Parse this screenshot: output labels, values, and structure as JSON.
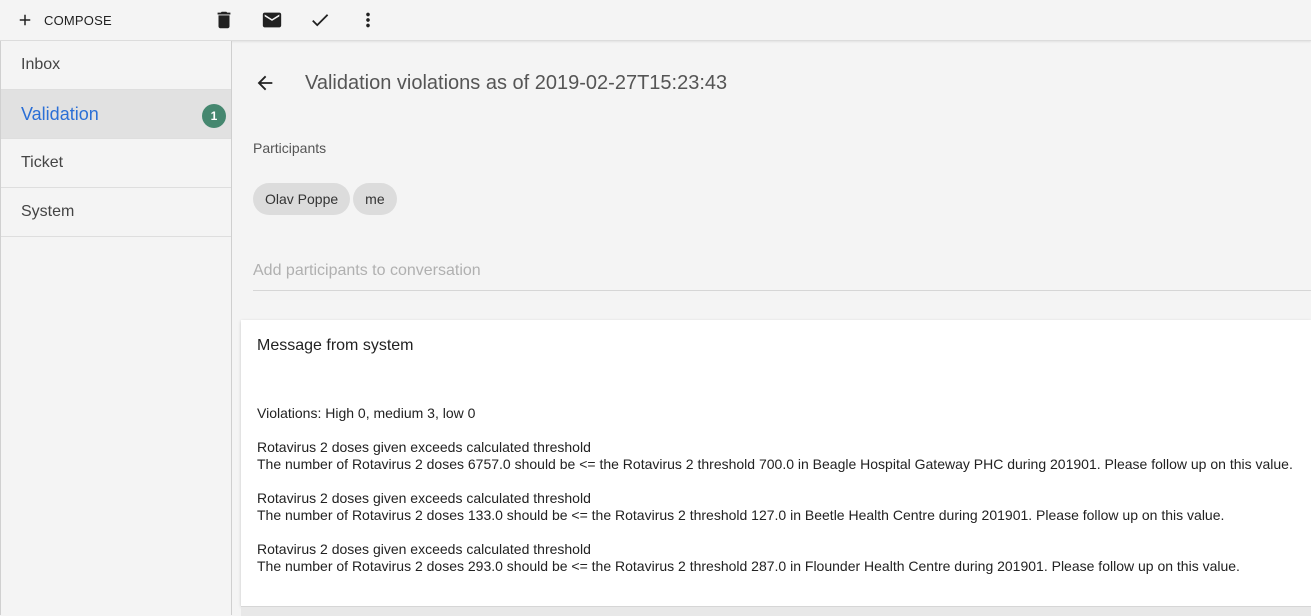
{
  "toolbar": {
    "compose_label": "COMPOSE",
    "icons": [
      "plus-icon",
      "trash-icon",
      "mail-icon",
      "check-icon",
      "more-vert-icon"
    ]
  },
  "sidebar": {
    "items": [
      {
        "label": "Inbox"
      },
      {
        "label": "Validation",
        "badge": "1"
      },
      {
        "label": "Ticket"
      },
      {
        "label": "System"
      }
    ],
    "active_color": "#2b6fd6",
    "badge_color": "#45876f"
  },
  "conversation": {
    "subject": "Validation violations as of 2019-02-27T15:23:43",
    "participants_label": "Participants",
    "participants": [
      "Olav Poppe",
      "me"
    ],
    "add_placeholder": "Add participants to conversation"
  },
  "message": {
    "title": "Message from system",
    "summary": "Violations: High 0, medium 3, low 0",
    "violations": [
      {
        "heading": "Rotavirus 2 doses given exceeds calculated threshold",
        "detail": "The number of Rotavirus 2 doses 6757.0 should be <= the Rotavirus 2 threshold 700.0 in Beagle Hospital Gateway PHC during 201901. Please follow up on this value."
      },
      {
        "heading": "Rotavirus 2 doses given exceeds calculated threshold",
        "detail": "The number of Rotavirus 2 doses 133.0 should be <= the Rotavirus 2 threshold 127.0 in Beetle Health Centre during 201901. Please follow up on this value."
      },
      {
        "heading": "Rotavirus 2 doses given exceeds calculated threshold",
        "detail": "The number of Rotavirus 2 doses 293.0 should be <= the Rotavirus 2 threshold 287.0 in Flounder Health Centre during 201901. Please follow up on this value."
      }
    ]
  }
}
